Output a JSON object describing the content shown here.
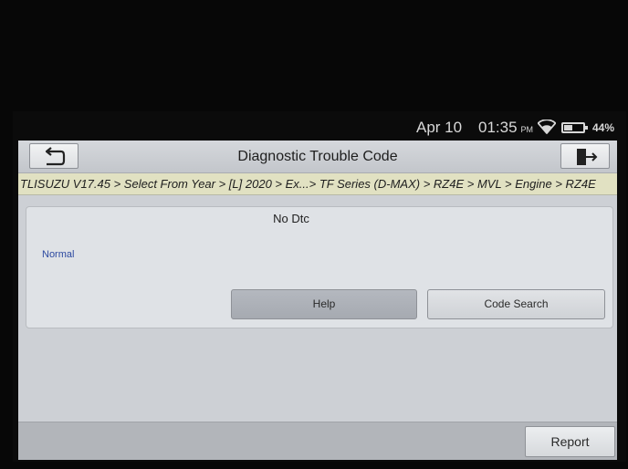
{
  "status_bar": {
    "date": "Apr 10",
    "time": "01:35",
    "ampm": "PM",
    "battery": "44%",
    "icons": [
      "wifi-icon",
      "battery-icon"
    ]
  },
  "header": {
    "title": "Diagnostic Trouble Code",
    "back_icon": "back-arrow-icon",
    "exit_icon": "exit-door-icon"
  },
  "breadcrumb": "TLISUZU V17.45 > Select From Year > [L] 2020 > Ex...> TF Series (D-MAX) > RZ4E > MVL > Engine > RZ4E",
  "dtc_panel": {
    "message": "No Dtc",
    "status": "Normal",
    "help_label": "Help",
    "code_search_label": "Code Search"
  },
  "footer": {
    "report_label": "Report"
  },
  "colors": {
    "breadcrumb_bg": "#e1e1c2",
    "status_text": "#2c49a0",
    "app_bg": "#cdd0d5"
  }
}
